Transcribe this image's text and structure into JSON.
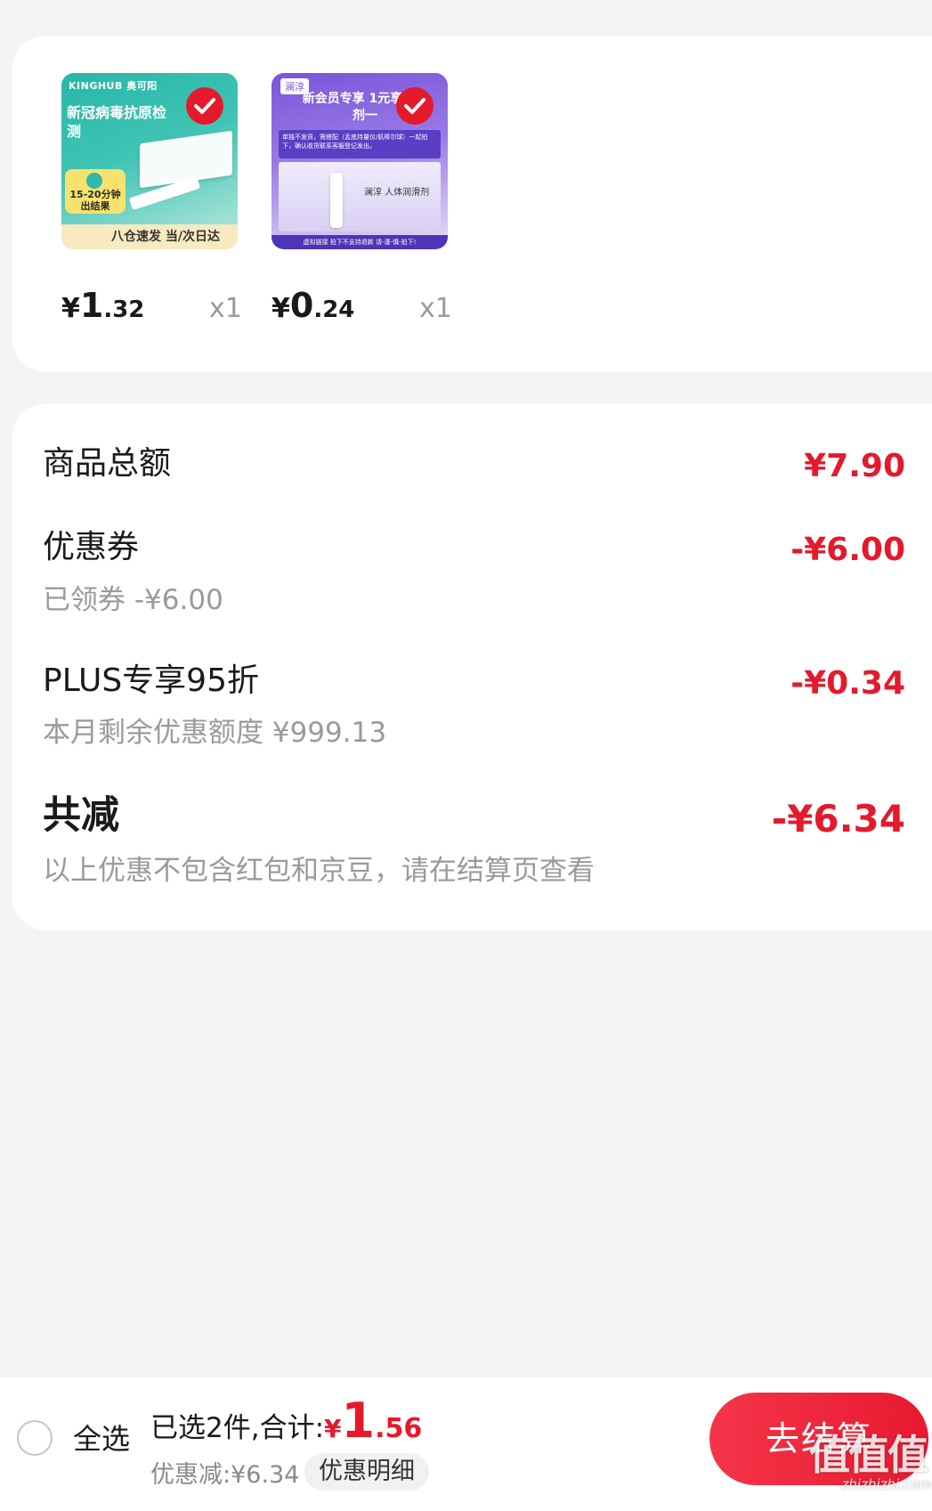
{
  "products": [
    {
      "image": {
        "brand": "KINGHUB 奥可阳",
        "headline": "新冠病毒抗原检测",
        "badge": "15-20分钟出结果",
        "footer": "八仓速发 当/次日达"
      },
      "price_yen": "¥",
      "price_int": "1",
      "price_dec": ".32",
      "qty": "x1"
    },
    {
      "image": {
        "brand": "澜淳",
        "headline": "新会员专享 1元享润滑剂一",
        "panel": "单独不发货，需搭配（孟底持量仪/肌棒尔球）一起拍下，确认收货联系客服登记发出。",
        "scene_text": "澜淳 人体润滑剂",
        "footer": "虚拟链接 拍下不支持退款 请-谨-慎-拍下!"
      },
      "price_yen": "¥",
      "price_int": "0",
      "price_dec": ".24",
      "qty": "x1"
    }
  ],
  "summary": {
    "goods_total_label": "商品总额",
    "goods_total_value": "¥7.90",
    "coupon_label": "优惠券",
    "coupon_sub": "已领券 -¥6.00",
    "coupon_value": "-¥6.00",
    "plus_label": "PLUS专享95折",
    "plus_sub": "本月剩余优惠额度 ¥999.13",
    "plus_value": "-¥0.34",
    "total_discount_label": "共减",
    "total_discount_value": "-¥6.34",
    "note": "以上优惠不包含红包和京豆，请在结算页查看"
  },
  "bottom_bar": {
    "select_all": "全选",
    "selected_text": "已选2件,合计:",
    "total_yen": "¥",
    "total_int": "1",
    "total_dec": ".56",
    "discount_text": "优惠减:¥6.34",
    "detail_button": "优惠明细",
    "checkout_button": "去结算"
  },
  "watermark": {
    "mark": "值值值",
    "domain": "zhizhizhi.com"
  },
  "colors": {
    "accent_red": "#e5192c",
    "background": "#f4f4f4",
    "card": "#ffffff",
    "muted_text": "#9a9a9a"
  },
  "icons": {
    "selected_check": "check-circle-icon",
    "select_all_radio": "radio-unchecked-icon"
  }
}
